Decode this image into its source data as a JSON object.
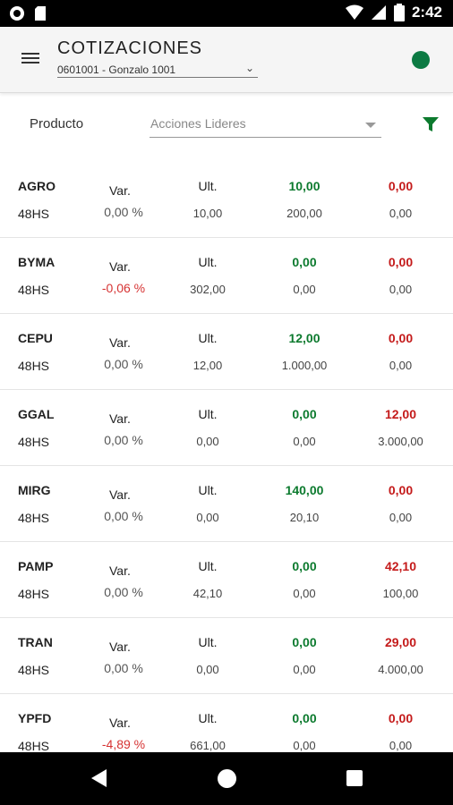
{
  "status_bar": {
    "time": "2:42",
    "icons": [
      "circle-record-icon",
      "sd-card-icon",
      "wifi-icon",
      "signal-icon",
      "battery-icon"
    ]
  },
  "header": {
    "title": "COTIZACIONES",
    "account": "0601001 - Gonzalo 1001",
    "status_color": "#0c7a43"
  },
  "filter": {
    "label": "Producto",
    "selected": "Acciones Lideres"
  },
  "labels": {
    "var": "Var.",
    "ult": "Ult."
  },
  "colors": {
    "bid": "#0c7a2e",
    "ask": "#c41a1a",
    "negative": "#d63333"
  },
  "quotes": [
    {
      "symbol": "AGRO",
      "term": "48HS",
      "variation": "0,00 %",
      "last": "10,00",
      "bid_price": "10,00",
      "bid_qty": "200,00",
      "ask_price": "0,00",
      "ask_qty": "0,00"
    },
    {
      "symbol": "BYMA",
      "term": "48HS",
      "variation": "-0,06 %",
      "last": "302,00",
      "bid_price": "0,00",
      "bid_qty": "0,00",
      "ask_price": "0,00",
      "ask_qty": "0,00"
    },
    {
      "symbol": "CEPU",
      "term": "48HS",
      "variation": "0,00 %",
      "last": "12,00",
      "bid_price": "12,00",
      "bid_qty": "1.000,00",
      "ask_price": "0,00",
      "ask_qty": "0,00"
    },
    {
      "symbol": "GGAL",
      "term": "48HS",
      "variation": "0,00 %",
      "last": "0,00",
      "bid_price": "0,00",
      "bid_qty": "0,00",
      "ask_price": "12,00",
      "ask_qty": "3.000,00"
    },
    {
      "symbol": "MIRG",
      "term": "48HS",
      "variation": "0,00 %",
      "last": "0,00",
      "bid_price": "140,00",
      "bid_qty": "20,10",
      "ask_price": "0,00",
      "ask_qty": "0,00"
    },
    {
      "symbol": "PAMP",
      "term": "48HS",
      "variation": "0,00 %",
      "last": "42,10",
      "bid_price": "0,00",
      "bid_qty": "0,00",
      "ask_price": "42,10",
      "ask_qty": "100,00"
    },
    {
      "symbol": "TRAN",
      "term": "48HS",
      "variation": "0,00 %",
      "last": "0,00",
      "bid_price": "0,00",
      "bid_qty": "0,00",
      "ask_price": "29,00",
      "ask_qty": "4.000,00"
    },
    {
      "symbol": "YPFD",
      "term": "48HS",
      "variation": "-4,89 %",
      "last": "661,00",
      "bid_price": "0,00",
      "bid_qty": "0,00",
      "ask_price": "0,00",
      "ask_qty": "0,00"
    }
  ],
  "nav": {
    "icons": [
      "back-icon",
      "home-icon",
      "recents-icon"
    ]
  }
}
